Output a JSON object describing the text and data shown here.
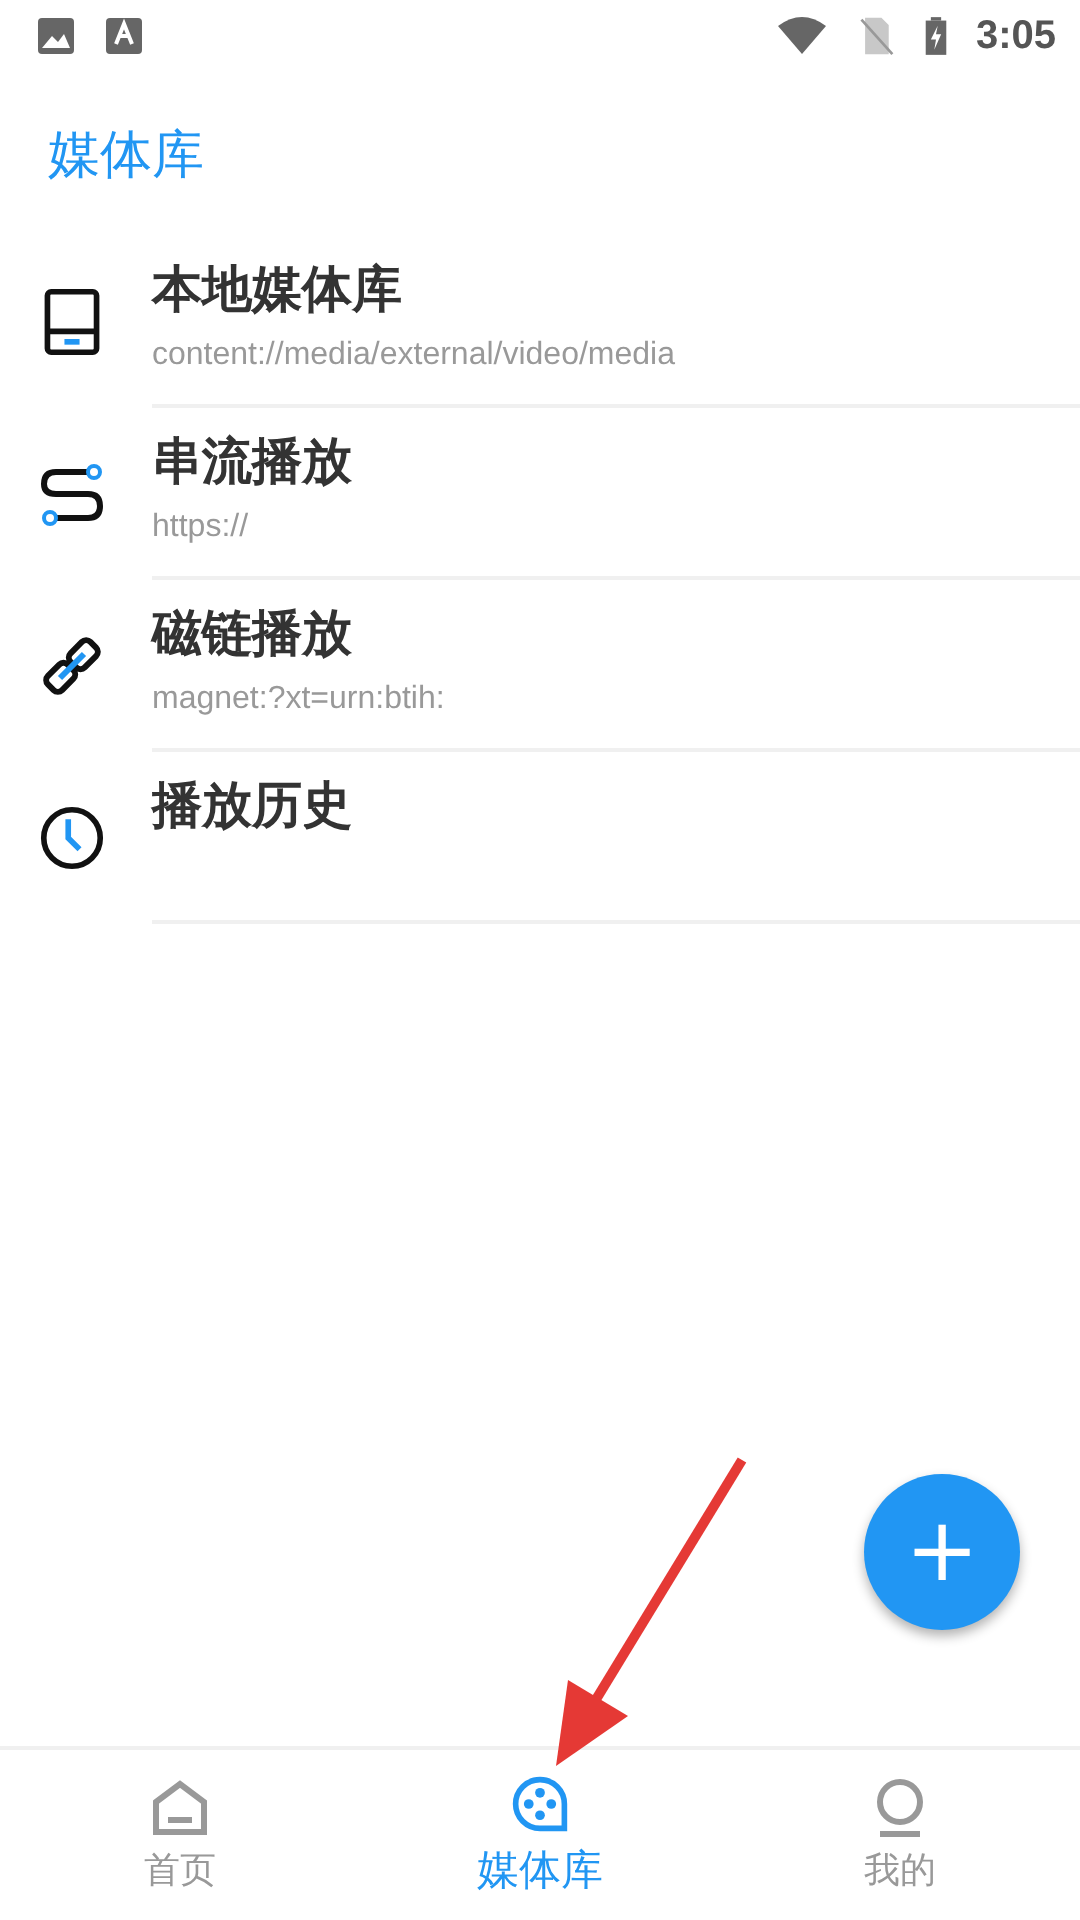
{
  "status_bar": {
    "time": "3:05"
  },
  "header": {
    "title": "媒体库"
  },
  "items": [
    {
      "kind": "device",
      "title": "本地媒体库",
      "subtitle": "content://media/external/video/media"
    },
    {
      "kind": "stream",
      "title": "串流播放",
      "subtitle": "https://"
    },
    {
      "kind": "magnet",
      "title": "磁链播放",
      "subtitle": "magnet:?xt=urn:btih:"
    },
    {
      "kind": "history",
      "title": "播放历史"
    }
  ],
  "fab": {
    "label": "+"
  },
  "nav": [
    {
      "kind": "home",
      "label": "首页",
      "selected": false
    },
    {
      "kind": "library",
      "label": "媒体库",
      "selected": true
    },
    {
      "kind": "profile",
      "label": "我的",
      "selected": false
    }
  ]
}
